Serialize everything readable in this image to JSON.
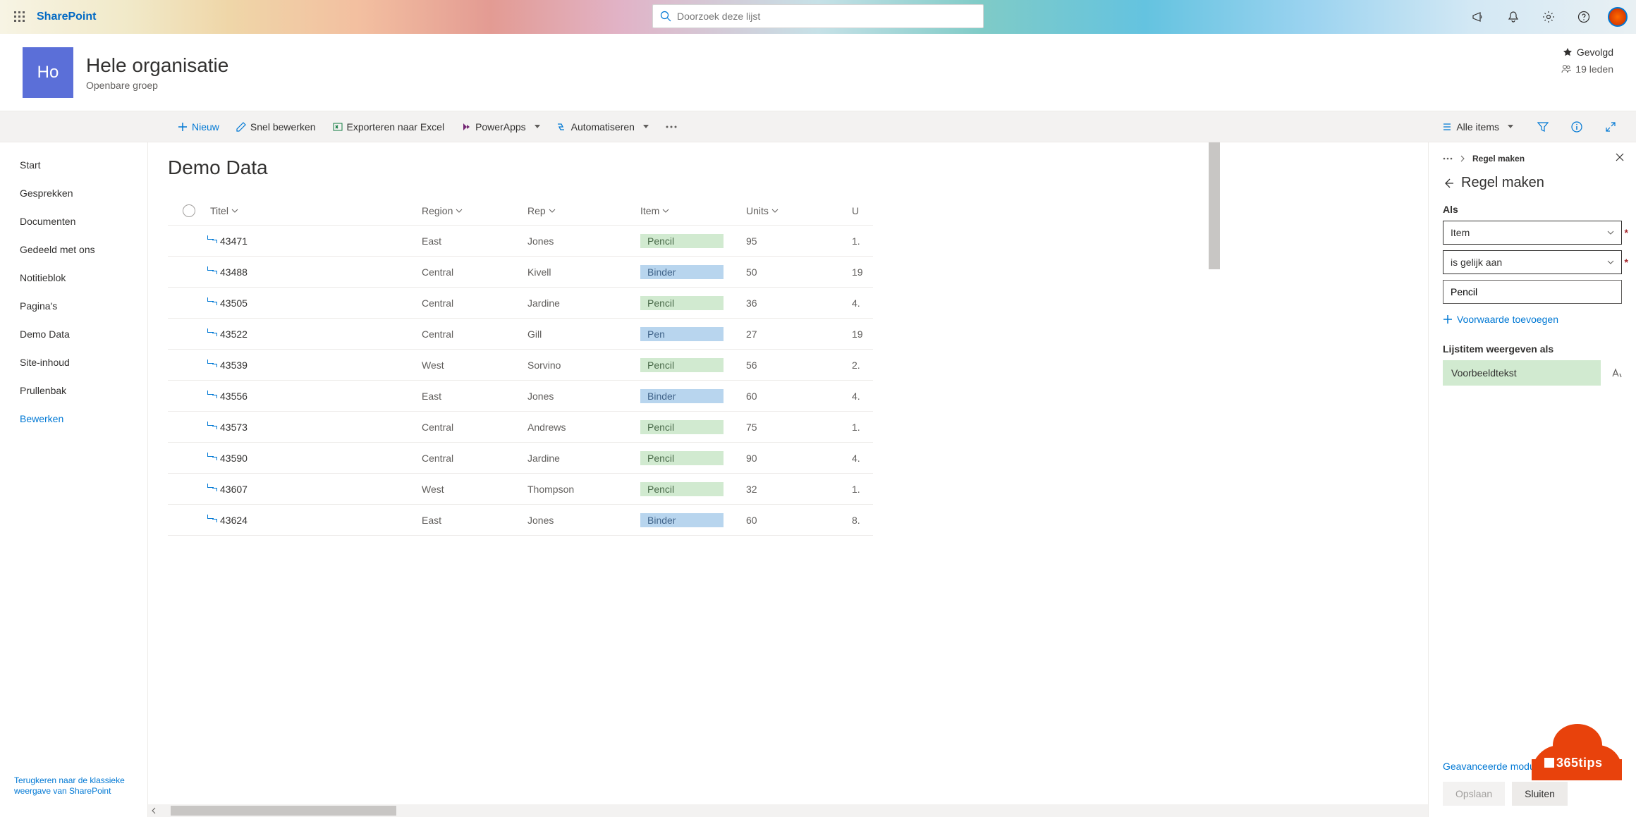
{
  "brand": "SharePoint",
  "search": {
    "placeholder": "Doorzoek deze lijst"
  },
  "site": {
    "logo_text": "Ho",
    "name": "Hele organisatie",
    "subtitle": "Openbare groep",
    "followed": "Gevolgd",
    "members": "19 leden"
  },
  "commands": {
    "new": "Nieuw",
    "quick_edit": "Snel bewerken",
    "export_excel": "Exporteren naar Excel",
    "powerapps": "PowerApps",
    "automate": "Automatiseren",
    "view_label": "Alle items"
  },
  "nav": {
    "items": [
      {
        "label": "Start"
      },
      {
        "label": "Gesprekken"
      },
      {
        "label": "Documenten"
      },
      {
        "label": "Gedeeld met ons"
      },
      {
        "label": "Notitieblok"
      },
      {
        "label": "Pagina's"
      },
      {
        "label": "Demo Data"
      },
      {
        "label": "Site-inhoud"
      },
      {
        "label": "Prullenbak"
      },
      {
        "label": "Bewerken",
        "link": true
      }
    ],
    "footer": "Terugkeren naar de klassieke weergave van SharePoint"
  },
  "list": {
    "title": "Demo Data",
    "columns": {
      "title": "Titel",
      "region": "Region",
      "rep": "Rep",
      "item": "Item",
      "units": "Units",
      "u": "U"
    },
    "rows": [
      {
        "title": "43471",
        "region": "East",
        "rep": "Jones",
        "item": "Pencil",
        "item_color": "green",
        "units": "95",
        "u": "1."
      },
      {
        "title": "43488",
        "region": "Central",
        "rep": "Kivell",
        "item": "Binder",
        "item_color": "blue",
        "units": "50",
        "u": "19"
      },
      {
        "title": "43505",
        "region": "Central",
        "rep": "Jardine",
        "item": "Pencil",
        "item_color": "green",
        "units": "36",
        "u": "4."
      },
      {
        "title": "43522",
        "region": "Central",
        "rep": "Gill",
        "item": "Pen",
        "item_color": "blue",
        "units": "27",
        "u": "19"
      },
      {
        "title": "43539",
        "region": "West",
        "rep": "Sorvino",
        "item": "Pencil",
        "item_color": "green",
        "units": "56",
        "u": "2."
      },
      {
        "title": "43556",
        "region": "East",
        "rep": "Jones",
        "item": "Binder",
        "item_color": "blue",
        "units": "60",
        "u": "4."
      },
      {
        "title": "43573",
        "region": "Central",
        "rep": "Andrews",
        "item": "Pencil",
        "item_color": "green",
        "units": "75",
        "u": "1."
      },
      {
        "title": "43590",
        "region": "Central",
        "rep": "Jardine",
        "item": "Pencil",
        "item_color": "green",
        "units": "90",
        "u": "4."
      },
      {
        "title": "43607",
        "region": "West",
        "rep": "Thompson",
        "item": "Pencil",
        "item_color": "green",
        "units": "32",
        "u": "1."
      },
      {
        "title": "43624",
        "region": "East",
        "rep": "Jones",
        "item": "Binder",
        "item_color": "blue",
        "units": "60",
        "u": "8."
      }
    ]
  },
  "panel": {
    "breadcrumb": "Regel maken",
    "title": "Regel maken",
    "if_label": "Als",
    "field_select": "Item",
    "cond_select": "is gelijk aan",
    "value": "Pencil",
    "add_condition": "Voorwaarde toevoegen",
    "show_as_label": "Lijstitem weergeven als",
    "sample_text": "Voorbeeldtekst",
    "advanced": "Geavanceerde modus",
    "save": "Opslaan",
    "close": "Sluiten"
  },
  "badge": "365tips"
}
